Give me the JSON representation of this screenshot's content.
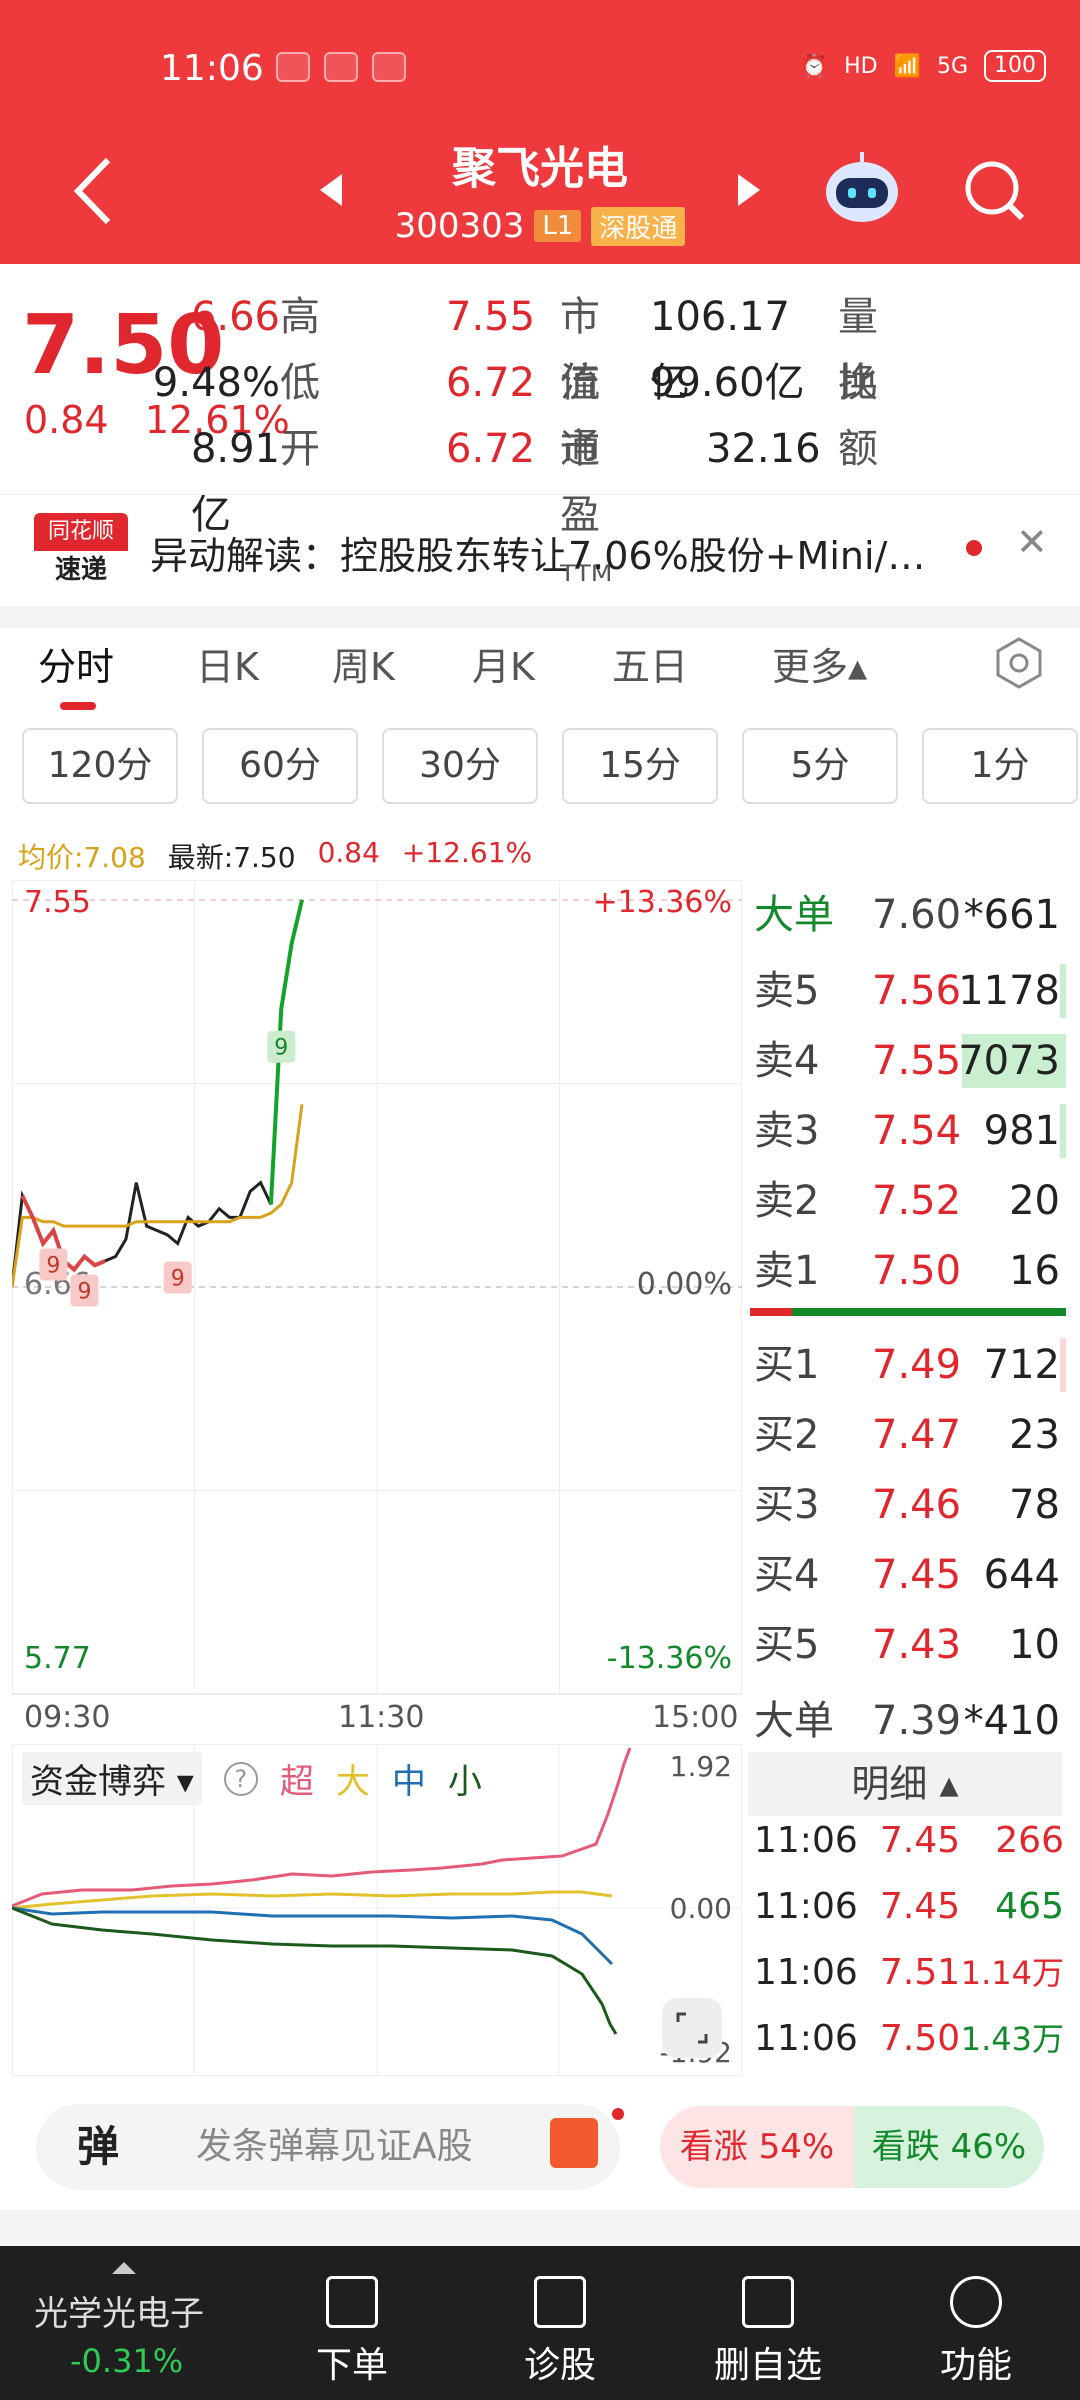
{
  "status_bar": {
    "time": "11:06",
    "battery": "100",
    "network": "5G",
    "hd": "HD"
  },
  "header": {
    "title": "聚飞光电",
    "code": "300303",
    "tag_level": "L1",
    "tag_channel": "深股通"
  },
  "quote": {
    "price": "7.50",
    "change": "0.84",
    "change_pct": "12.61%",
    "rows": [
      {
        "l1": "高",
        "v1": "7.55",
        "l2": "市值",
        "v2": "106.17亿",
        "l3": "量比",
        "v3": "6.66"
      },
      {
        "l1": "低",
        "v1": "6.72",
        "l2": "流通",
        "v2": "99.60亿",
        "l3": "换",
        "v3": "9.48%"
      },
      {
        "l1": "开",
        "v1": "6.72",
        "l2": "市盈ᵀᵀᴹ",
        "v2": "32.16",
        "l3": "额",
        "v3": "8.91亿"
      }
    ]
  },
  "alert": {
    "logo_top": "同花顺",
    "logo_bottom": "速递",
    "text": "异动解读：控股股东转让7.06%股份+Mini/…"
  },
  "tabs": [
    "分时",
    "日K",
    "周K",
    "月K",
    "五日",
    "更多▴"
  ],
  "periods": [
    "120分",
    "60分",
    "30分",
    "15分",
    "5分",
    "1分"
  ],
  "chart_info": {
    "avg_label": "均价:7.08",
    "latest_label": "最新:7.50",
    "change": "0.84",
    "change_pct": "+12.61%"
  },
  "chart_data": {
    "type": "line",
    "y_top_label": "7.55",
    "y_mid_label": "6.66",
    "y_bottom_label": "5.77",
    "pct_top_label": "+13.36%",
    "pct_mid_label": "0.00%",
    "pct_bottom_label": "-13.36%",
    "x_labels": [
      "09:30",
      "11:30",
      "15:00"
    ],
    "ylim": [
      5.77,
      7.55
    ],
    "series": [
      {
        "values": [
          6.66,
          6.87,
          6.82,
          6.76,
          6.79,
          6.72,
          6.7,
          6.73,
          6.71,
          6.72,
          6.73,
          6.77,
          6.9,
          6.8,
          6.79,
          6.78,
          6.76,
          6.82,
          6.8,
          6.81,
          6.84,
          6.82,
          6.82,
          6.88,
          6.9,
          6.85,
          7.3,
          7.45,
          7.55
        ]
      },
      {
        "values": [
          6.66,
          6.82,
          6.82,
          6.81,
          6.81,
          6.8,
          6.8,
          6.8,
          6.8,
          6.8,
          6.8,
          6.8,
          6.81,
          6.81,
          6.81,
          6.81,
          6.81,
          6.81,
          6.81,
          6.81,
          6.81,
          6.81,
          6.82,
          6.82,
          6.82,
          6.83,
          6.85,
          6.9,
          7.08
        ]
      }
    ],
    "markers": [
      "9",
      "9",
      "9",
      "9"
    ]
  },
  "orderbook": {
    "big_sell": {
      "label": "大单",
      "price": "7.60",
      "vol": "*661"
    },
    "asks": [
      {
        "label": "卖5",
        "price": "7.56",
        "vol": "1178"
      },
      {
        "label": "卖4",
        "price": "7.55",
        "vol": "7073"
      },
      {
        "label": "卖3",
        "price": "7.54",
        "vol": "981"
      },
      {
        "label": "卖2",
        "price": "7.52",
        "vol": "20"
      },
      {
        "label": "卖1",
        "price": "7.50",
        "vol": "16"
      }
    ],
    "bids": [
      {
        "label": "买1",
        "price": "7.49",
        "vol": "712"
      },
      {
        "label": "买2",
        "price": "7.47",
        "vol": "23"
      },
      {
        "label": "买3",
        "price": "7.46",
        "vol": "78"
      },
      {
        "label": "买4",
        "price": "7.45",
        "vol": "644"
      },
      {
        "label": "买5",
        "price": "7.43",
        "vol": "10"
      }
    ],
    "big_buy": {
      "label": "大单",
      "price": "7.39",
      "vol": "*410"
    }
  },
  "fund_panel": {
    "title": "资金博弈",
    "legend": [
      "超",
      "大",
      "中",
      "小"
    ],
    "legend_colors": [
      "#e45b78",
      "#e3c12c",
      "#1f6fb2",
      "#1b5a1b"
    ],
    "top_label": "1.92",
    "mid_label": "0.00",
    "bottom_label": "-1.92"
  },
  "detail": {
    "title": "明细",
    "trades": [
      {
        "time": "11:06",
        "price": "7.45",
        "vol": "266"
      },
      {
        "time": "11:06",
        "price": "7.45",
        "vol": "465"
      },
      {
        "time": "11:06",
        "price": "7.51",
        "vol": "1.14万"
      },
      {
        "time": "11:06",
        "price": "7.50",
        "vol": "1.43万"
      }
    ]
  },
  "comment_bar": {
    "dan_label": "弹",
    "placeholder": "发条弹幕见证A股",
    "up_label": "看涨 54%",
    "down_label": "看跌 46%"
  },
  "bottom_nav": {
    "sector": "光学光电子",
    "sector_change": "-0.31%",
    "items": [
      "下单",
      "诊股",
      "删自选",
      "功能"
    ]
  }
}
